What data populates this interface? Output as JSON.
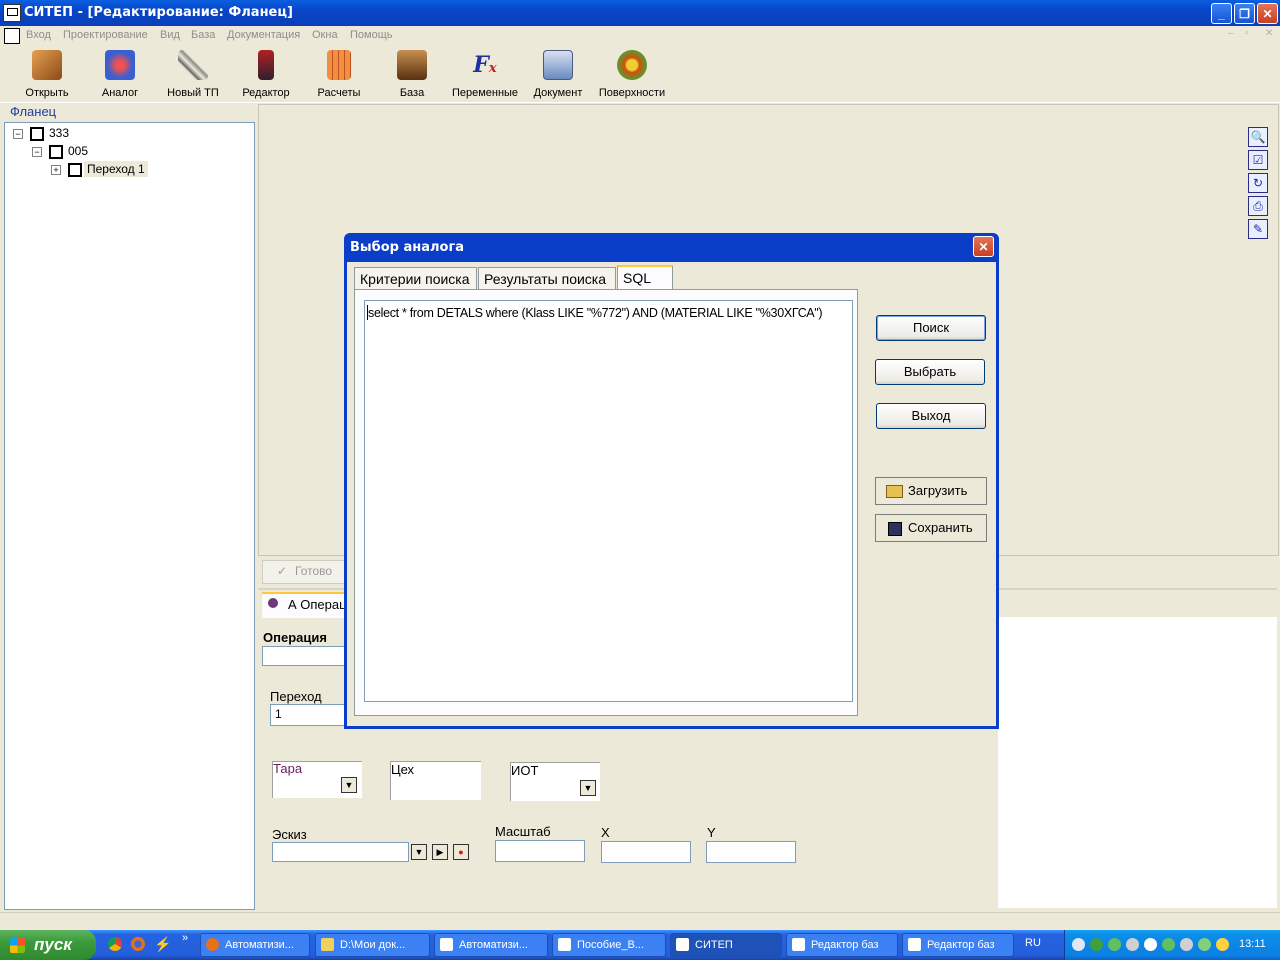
{
  "window": {
    "title": "СИТЕП - [Редактирование: Фланец]",
    "controls": {
      "minimize": "_",
      "restore": "❐",
      "close": "✕"
    }
  },
  "menu": {
    "items": [
      "Вход",
      "Проектирование",
      "Вид",
      "База",
      "Документация",
      "Окна",
      "Помощь"
    ],
    "mdi_controls": {
      "minimize": "–",
      "restore": "▫",
      "close": "✕"
    }
  },
  "toolbar": {
    "buttons": [
      {
        "label": "Открыть",
        "icon": "open-camera-icon",
        "color": "#C8702A"
      },
      {
        "label": "Аналог",
        "icon": "analog-icon",
        "color": "#3A5FD0"
      },
      {
        "label": "Новый ТП",
        "icon": "new-process-icon",
        "color": "#6A6A6A"
      },
      {
        "label": "Редактор",
        "icon": "editor-icon",
        "color": "#B02020"
      },
      {
        "label": "Расчеты",
        "icon": "calculator-icon",
        "color": "#E0782A"
      },
      {
        "label": "База",
        "icon": "database-box-icon",
        "color": "#7A4A20"
      },
      {
        "label": "Переменные",
        "icon": "function-fx-icon",
        "color": "#2030A0"
      },
      {
        "label": "Документ",
        "icon": "document-search-icon",
        "color": "#4A6AA0"
      },
      {
        "label": "Поверхности",
        "icon": "gear-surface-icon",
        "color": "#D05010"
      }
    ]
  },
  "tree": {
    "title": "Фланец",
    "nodes": [
      {
        "label": "333",
        "expander": "−"
      },
      {
        "label": "005",
        "expander": "−"
      },
      {
        "label": "Переход 1",
        "expander": "+"
      }
    ]
  },
  "side_tools": [
    "zoom-icon",
    "check-frame-icon",
    "refresh-icon",
    "print-icon",
    "magic-wand-icon"
  ],
  "side_tool_glyphs": [
    "🔍",
    "☑",
    "↻",
    "⎙",
    "✎"
  ],
  "ready_button": {
    "label": "Готово",
    "glyph": "✓"
  },
  "operation_tab": {
    "label": "А Операция"
  },
  "form": {
    "operation_label": "Операция",
    "operation_value": "",
    "transition_label": "Переход",
    "transition_value": "1",
    "tara_label": "Тара",
    "tara_value": "",
    "workshop_label": "Цех",
    "workshop_value": "",
    "iot_label": "ИОТ",
    "iot_value": "",
    "sketch_label": "Эскиз",
    "sketch_value": "",
    "scale_label": "Масштаб",
    "scale_value": "",
    "x_label": "X",
    "x_value": "",
    "y_label": "Y",
    "y_value": "",
    "dropdown_glyph": "▼",
    "play_glyph": "▶",
    "record_glyph": "●"
  },
  "dialog": {
    "title": "Выбор аналога",
    "close_glyph": "✕",
    "tabs": [
      "Критерии поиска",
      "Результаты поиска",
      "SQL"
    ],
    "active_tab": "SQL",
    "sql_text": "select * from DETALS where  (Klass LIKE \"%772\")  AND (MATERIAL LIKE \"%30ХГСА\")",
    "buttons": {
      "search": "Поиск",
      "select": "Выбрать",
      "exit": "Выход",
      "load": "Загрузить",
      "save": "Сохранить"
    }
  },
  "taskbar": {
    "start": "пуск",
    "quicklaunch_overflow": "»",
    "tasks": [
      "Автоматизи...",
      "D:\\Мои док...",
      "Автоматизи...",
      "Пособие_В...",
      "СИТЕП",
      "Редактор баз",
      "Редактор баз"
    ],
    "active_task": "СИТЕП",
    "language": "RU",
    "clock": "13:11"
  }
}
